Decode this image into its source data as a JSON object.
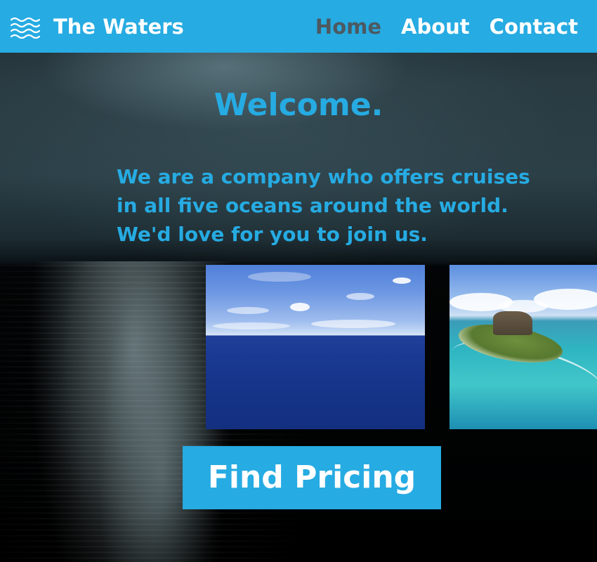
{
  "header": {
    "logo_icon": "waves-icon",
    "brand": "The Waters",
    "nav": [
      {
        "label": "Home",
        "active": true
      },
      {
        "label": "About",
        "active": false
      },
      {
        "label": "Contact",
        "active": false
      }
    ]
  },
  "hero": {
    "title": "Welcome.",
    "lines": [
      "We are a company who offers cruises",
      "in all five oceans around the world.",
      "We'd love for you to join us."
    ]
  },
  "images": [
    {
      "name": "open-ocean-photo"
    },
    {
      "name": "tropical-island-photo"
    }
  ],
  "cta": {
    "label": "Find Pricing"
  },
  "colors": {
    "accent": "#26abe2",
    "nav_active": "#4d5961",
    "header_text": "#ffffff"
  }
}
